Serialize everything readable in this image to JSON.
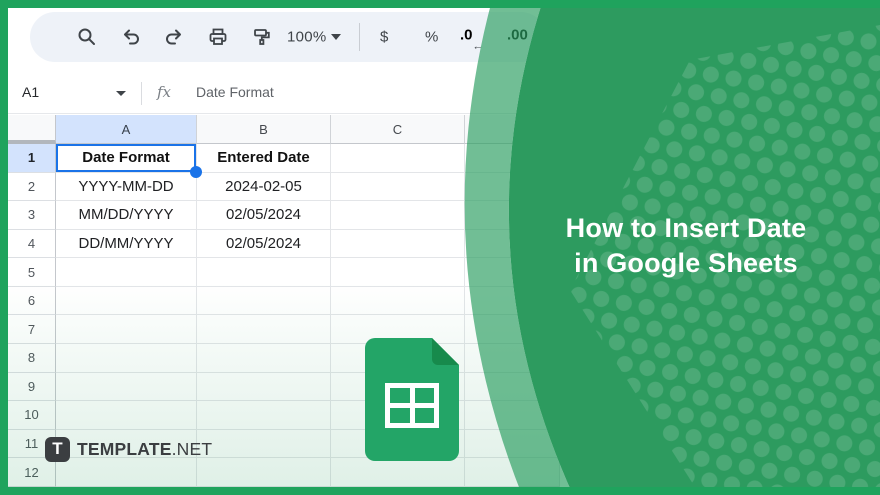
{
  "toolbar": {
    "icons": [
      "search",
      "undo",
      "redo",
      "print",
      "paint-format"
    ],
    "zoom_value": "100%",
    "currency_label": "$",
    "percent_label": "%",
    "decrease_decimal_label": ".0",
    "decrease_decimal_arrow": "←",
    "increase_decimal_label": ".00",
    "increase_decimal_arrow": "→"
  },
  "formula_bar": {
    "cell_reference": "A1",
    "fx_label": "fx",
    "content": "Date Format"
  },
  "grid": {
    "columns": [
      "A",
      "B",
      "C",
      ""
    ],
    "row_numbers": [
      "1",
      "2",
      "3",
      "4",
      "5",
      "6",
      "7",
      "8",
      "9",
      "10",
      "11",
      "12"
    ],
    "cells": [
      [
        "Date Format",
        "Entered Date",
        "",
        ""
      ],
      [
        "YYYY-MM-DD",
        "2024-02-05",
        "",
        ""
      ],
      [
        "MM/DD/YYYY",
        "02/05/2024",
        "",
        ""
      ],
      [
        "DD/MM/YYYY",
        "02/05/2024",
        "",
        ""
      ]
    ],
    "selected_cell": "A1"
  },
  "panel": {
    "title_line1": "How to Insert Date",
    "title_line2": "in Google Sheets"
  },
  "branding": {
    "logo_letter": "T",
    "logo_name": "TEMPLATE",
    "logo_tld": ".NET"
  },
  "colors": {
    "frame_green": "#1fa35d",
    "panel_green": "#2d9b5f",
    "band_green": "rgba(43,158,97,0.67)",
    "selection_blue": "#1a73e8",
    "header_blue": "#d3e3fd",
    "sheets_icon_green": "#23a567",
    "sheets_icon_fold": "#178a4c"
  }
}
